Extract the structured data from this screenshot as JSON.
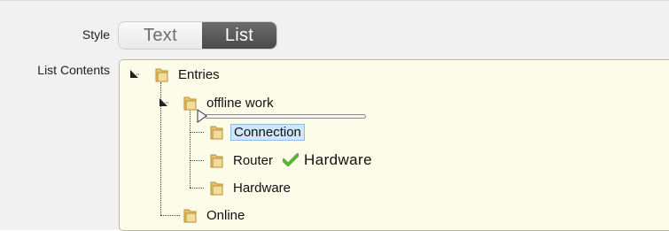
{
  "form": {
    "style_label": "Style",
    "contents_label": "List Contents"
  },
  "style_toggle": {
    "options": [
      "Text",
      "List"
    ],
    "selected": "List"
  },
  "tree": {
    "root": "Entries",
    "group": "offline work",
    "items": [
      "Connection",
      "Router",
      "Hardware"
    ],
    "other": "Online",
    "drag_label": "Hardware",
    "selected": "Connection"
  },
  "colors": {
    "tree_bg": "#fcfce9",
    "toggle_active": "#555555",
    "selection": "#cfe6fb",
    "check": "#56b433"
  }
}
